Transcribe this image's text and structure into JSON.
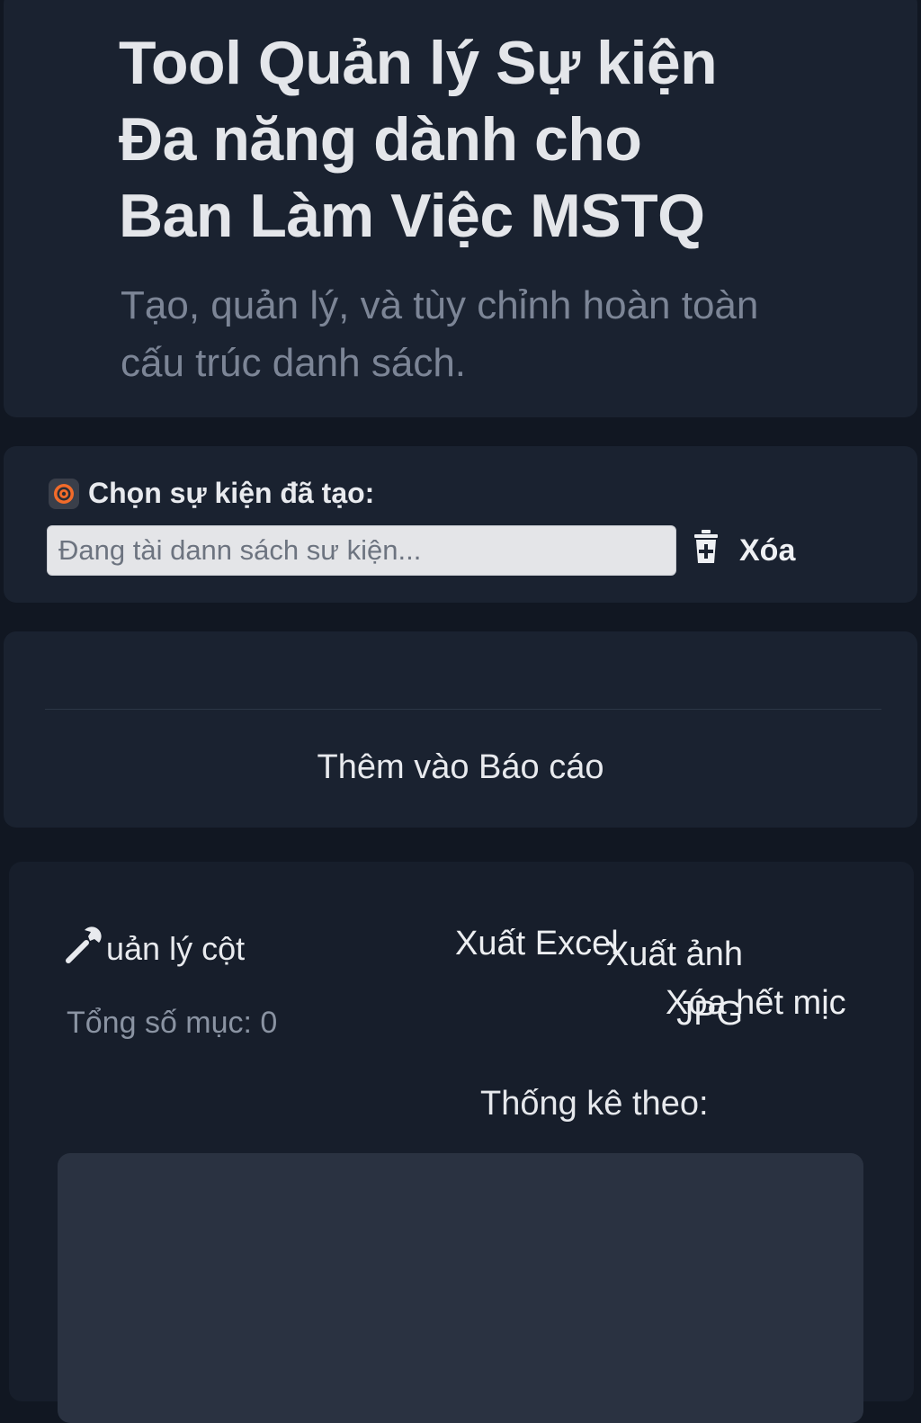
{
  "header": {
    "title_line1": "Tool Quản lý Sự kiện",
    "title_line2": "Đa năng dành cho",
    "title_line3": "Ban Làm Việc MSTQ",
    "subtitle_line1": "Tạo, quản lý, và tùy chỉnh hoàn toàn",
    "subtitle_line2": "cấu trúc danh sách."
  },
  "event_selector": {
    "icon": "target-icon",
    "label": "Chọn sự kiện đã tạo:",
    "placeholder": "Đang tài dann sách sư kiện...",
    "delete_icon": "trash-icon",
    "delete_label": "Xóa"
  },
  "report": {
    "add_label": "Thêm vào Báo cáo"
  },
  "columns": {
    "manage_icon": "wrench-icon",
    "manage_label": "uản lý cột",
    "total_label": "Tổng số mục: 0",
    "export_excel_label": "Xuất Excel",
    "export_image_line1": "Xuất ảnh",
    "export_image_line2": "JPG",
    "clear_all_label": "Xóa hết mịc",
    "stats_label": "Thống kê theo:"
  },
  "colors": {
    "background": "#111722",
    "card": "#1a2230",
    "accent_icon": "#f26b2a"
  }
}
